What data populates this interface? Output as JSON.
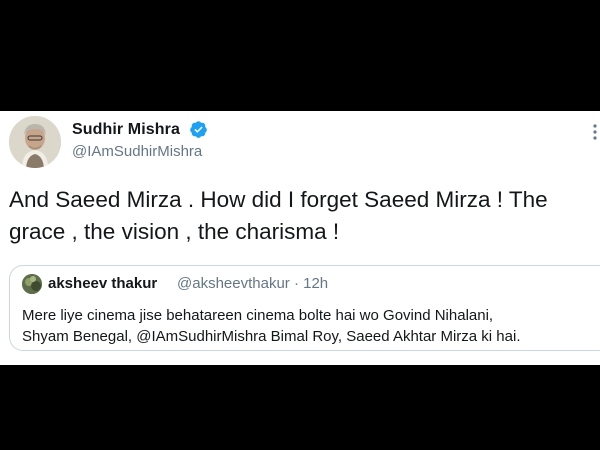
{
  "tweet": {
    "author": {
      "display_name": "Sudhir Mishra",
      "handle": "@IAmSudhirMishra",
      "verified": true
    },
    "text_lines": [
      "And Saeed Mirza . How did I forget Saeed Mirza ! The",
      "grace , the vision , the charisma !"
    ]
  },
  "quoted_tweet": {
    "display_name": "aksheev thakur",
    "meta": "@aksheevthakur · 12h",
    "text_lines": [
      "Mere liye cinema jise behatareen cinema bolte hai wo Govind Nihalani,",
      "Shyam Benegal, @IAmSudhirMishra Bimal Roy, Saeed Akhtar Mirza ki hai."
    ]
  },
  "icons": {
    "verified": "verified-badge-icon",
    "more": "more-options-icon"
  },
  "colors": {
    "background": "#000000",
    "card": "#ffffff",
    "text_primary": "#14171a",
    "text_secondary": "#657786",
    "verified_blue": "#1da1f2",
    "quote_border": "#ccd6dd"
  }
}
